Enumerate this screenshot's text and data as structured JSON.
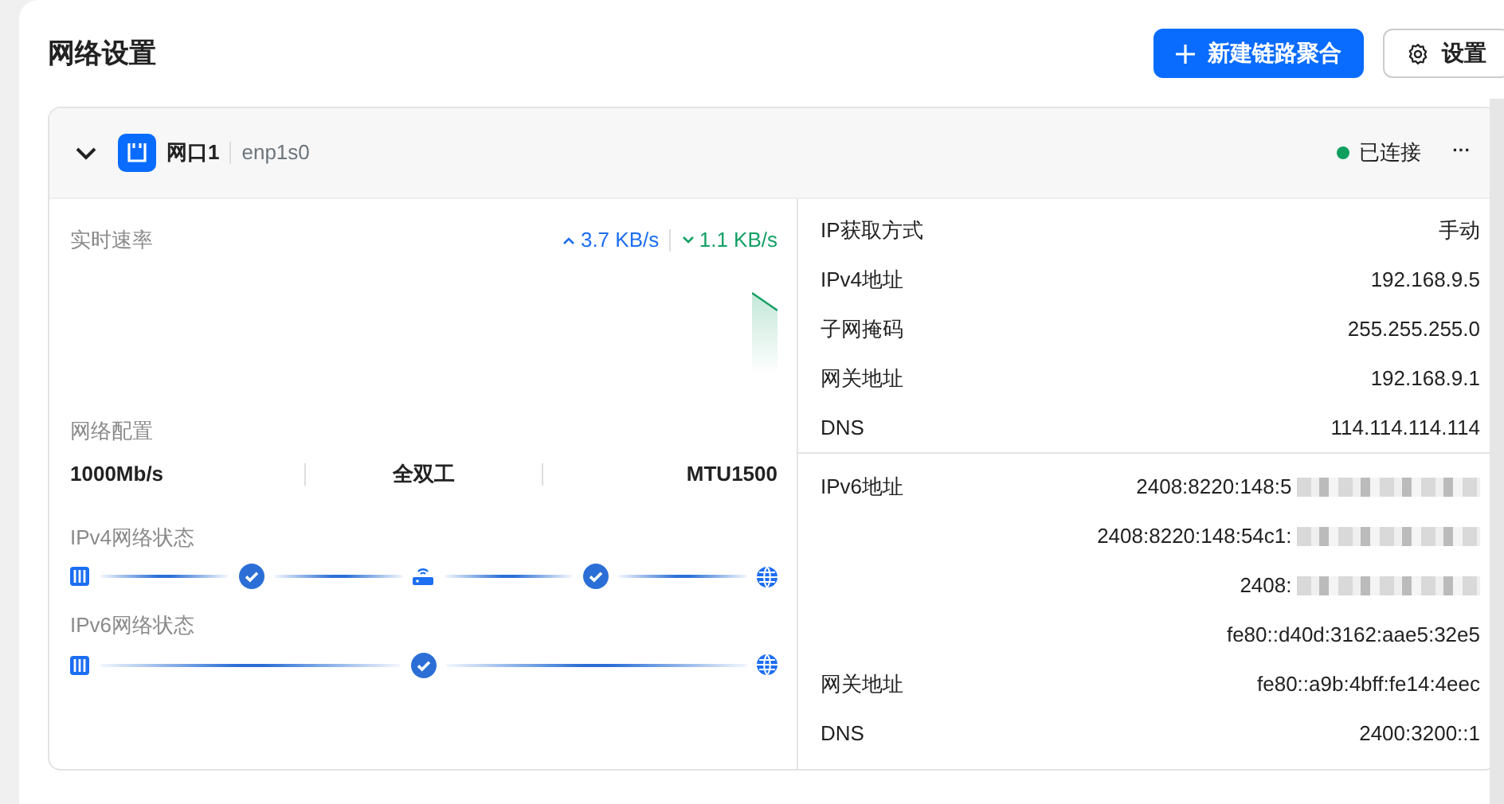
{
  "page_title": "网络设置",
  "actions": [
    {
      "kind": "primary",
      "label": "新建链路聚合"
    },
    {
      "kind": "outline",
      "label": "设置"
    }
  ],
  "port": {
    "expanded": true,
    "name": "网口1",
    "device": "enp1s0",
    "status": "已连接",
    "connected": true,
    "more": "···",
    "speed": {
      "label": "实时速率",
      "upload": "3.7 KB/s",
      "download": "1.1 KB/s"
    },
    "config": {
      "label": "网络配置",
      "values": [
        "1000Mb/s",
        "全双工",
        "MTU1500"
      ]
    },
    "paths": [
      {
        "label": "IPv4网络状态",
        "steps": [
          {
            "kind": "port"
          },
          {
            "kind": "check"
          },
          {
            "kind": "router"
          },
          {
            "kind": "check"
          },
          {
            "kind": "globe"
          }
        ]
      },
      {
        "label": "IPv6网络状态",
        "steps": [
          {
            "kind": "port"
          },
          {
            "kind": "check"
          },
          {
            "kind": "globe"
          }
        ]
      }
    ],
    "ipv4": [
      {
        "label": "IP获取方式",
        "values": [
          {
            "text": "手动"
          }
        ]
      },
      {
        "label": "IPv4地址",
        "values": [
          {
            "text": "192.168.9.5"
          }
        ]
      },
      {
        "label": "子网掩码",
        "values": [
          {
            "text": "255.255.255.0"
          }
        ]
      },
      {
        "label": "网关地址",
        "values": [
          {
            "text": "192.168.9.1"
          }
        ]
      },
      {
        "label": "DNS",
        "values": [
          {
            "text": "114.114.114.114"
          }
        ]
      }
    ],
    "ipv6": [
      {
        "label": "IPv6地址",
        "values": [
          {
            "text": "2408:8220:148:5",
            "redacted": true
          },
          {
            "text": "2408:8220:148:54c1:",
            "redacted": true
          },
          {
            "text": "2408:",
            "redacted": true
          },
          {
            "text": "fe80::d40d:3162:aae5:32e5",
            "redacted": false
          }
        ]
      },
      {
        "label": "网关地址",
        "values": [
          {
            "text": "fe80::a9b:4bff:fe14:4eec"
          }
        ]
      },
      {
        "label": "DNS",
        "values": [
          {
            "text": "2400:3200::1"
          }
        ]
      }
    ]
  }
}
